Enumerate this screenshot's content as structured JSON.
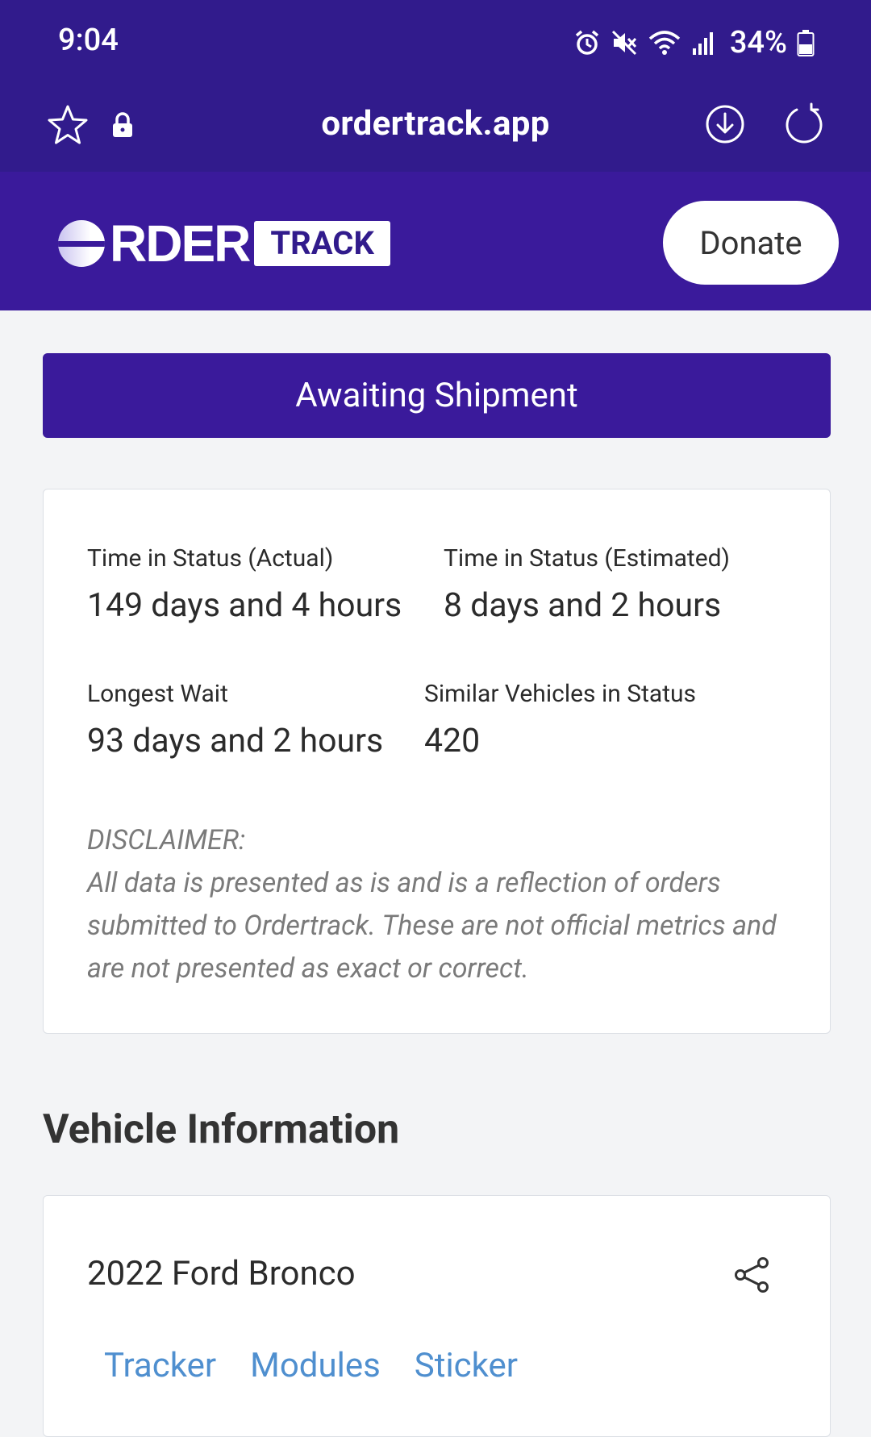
{
  "status_bar": {
    "time": "9:04",
    "battery_percent": "34%",
    "icons": [
      "alarm-icon",
      "mute-icon",
      "wifi-icon",
      "signal-icon",
      "battery-icon"
    ]
  },
  "browser": {
    "url": "ordertrack.app",
    "icons": [
      "star-icon",
      "lock-icon",
      "download-icon",
      "reload-icon"
    ]
  },
  "app_header": {
    "logo_word": "RDER",
    "logo_track": "TRACK",
    "donate_label": "Donate"
  },
  "status_banner": {
    "label": "Awaiting Shipment"
  },
  "stats": {
    "actual_label": "Time in Status (Actual)",
    "actual_value": "149 days and 4 hours",
    "estimated_label": "Time in Status (Estimated)",
    "estimated_value": "8 days and 2 hours",
    "longest_label": "Longest Wait",
    "longest_value": "93 days and 2 hours",
    "similar_label": "Similar Vehicles in Status",
    "similar_value": "420"
  },
  "disclaimer": {
    "title": "DISCLAIMER:",
    "text": "All data is presented as is and is a reflection of orders submitted to Ordertrack. These are not official metrics and are not presented as exact or correct."
  },
  "vehicle": {
    "section_title": "Vehicle Information",
    "name": "2022 Ford Bronco",
    "tabs": [
      {
        "label": "Tracker"
      },
      {
        "label": "Modules"
      },
      {
        "label": "Sticker"
      }
    ]
  },
  "colors": {
    "header_bg": "#311b8c",
    "brand_purple": "#3a1a9b",
    "link_blue": "#4f8fcf",
    "page_bg": "#f3f4f6"
  }
}
